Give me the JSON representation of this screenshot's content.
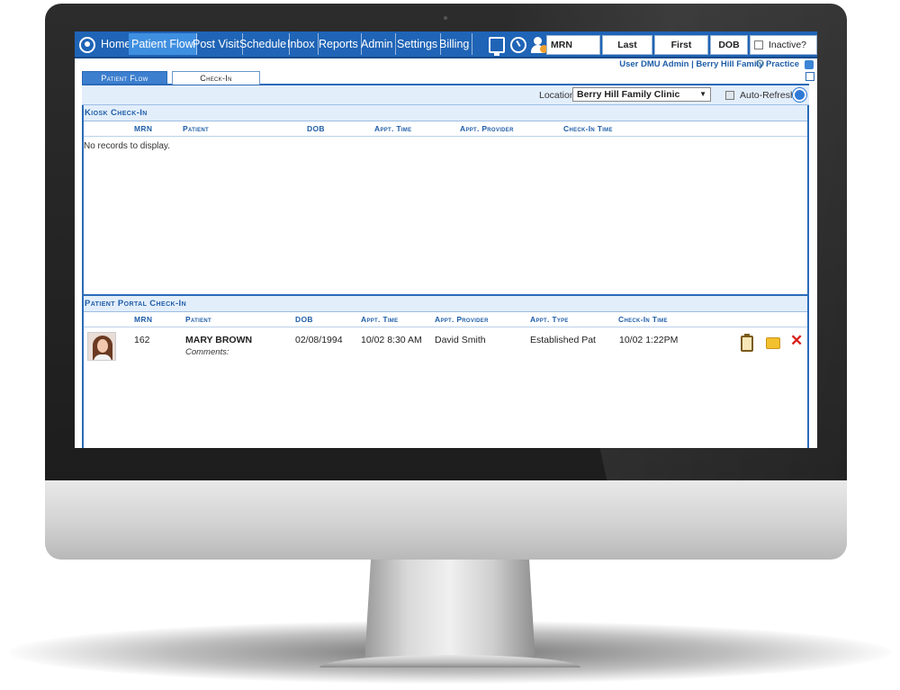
{
  "nav": {
    "items": [
      "Home",
      "Patient Flow",
      "Post Visit",
      "Schedule",
      "Inbox",
      "Reports",
      "Admin",
      "Settings",
      "Billing"
    ],
    "active": "Patient Flow",
    "search_mrn": "MRN",
    "search_last": "Last",
    "search_first": "First",
    "search_dob": "DOB",
    "inactive_label": "Inactive?"
  },
  "user_bar": "User DMU Admin | Berry Hill Family Practice",
  "tabs": [
    "Patient Flow",
    "Check-In"
  ],
  "location": {
    "label": "Location",
    "value": "Berry Hill Family Clinic",
    "auto_refresh": "Auto-Refresh",
    "auto_refresh_checked": true
  },
  "kiosk": {
    "title": "Kiosk Check-In",
    "columns": [
      "MRN",
      "Patient",
      "DOB",
      "Appt. Time",
      "Appt. Provider",
      "Check-In Time"
    ],
    "empty_text": "No records to display."
  },
  "portal": {
    "title": "Patient Portal Check-In",
    "columns": [
      "MRN",
      "Patient",
      "DOB",
      "Appt. Time",
      "Appt. Provider",
      "Appt. Type",
      "Check-In Time"
    ],
    "rows": [
      {
        "mrn": "162",
        "patient": "MARY BROWN",
        "comments": "Comments:",
        "dob": "02/08/1994",
        "appt_time": "10/02 8:30 AM",
        "provider": "David Smith",
        "appt_type": "Established Pat",
        "checkin_time": "10/02 1:22PM"
      }
    ]
  },
  "icons": {
    "home": "home-icon",
    "monitor": "monitor-icon",
    "gauge": "gauge-icon",
    "add_user": "add-user-icon",
    "search": "search-icon",
    "popout": "popout-icon",
    "refresh": "refresh-icon",
    "clipboard": "clipboard-icon",
    "folder": "folder-icon",
    "delete": "delete-icon"
  },
  "colors": {
    "nav_bg": "#1f64b6",
    "nav_active": "#3f8fe0",
    "header_text": "#1f5ea8",
    "delete": "#d8201c"
  }
}
